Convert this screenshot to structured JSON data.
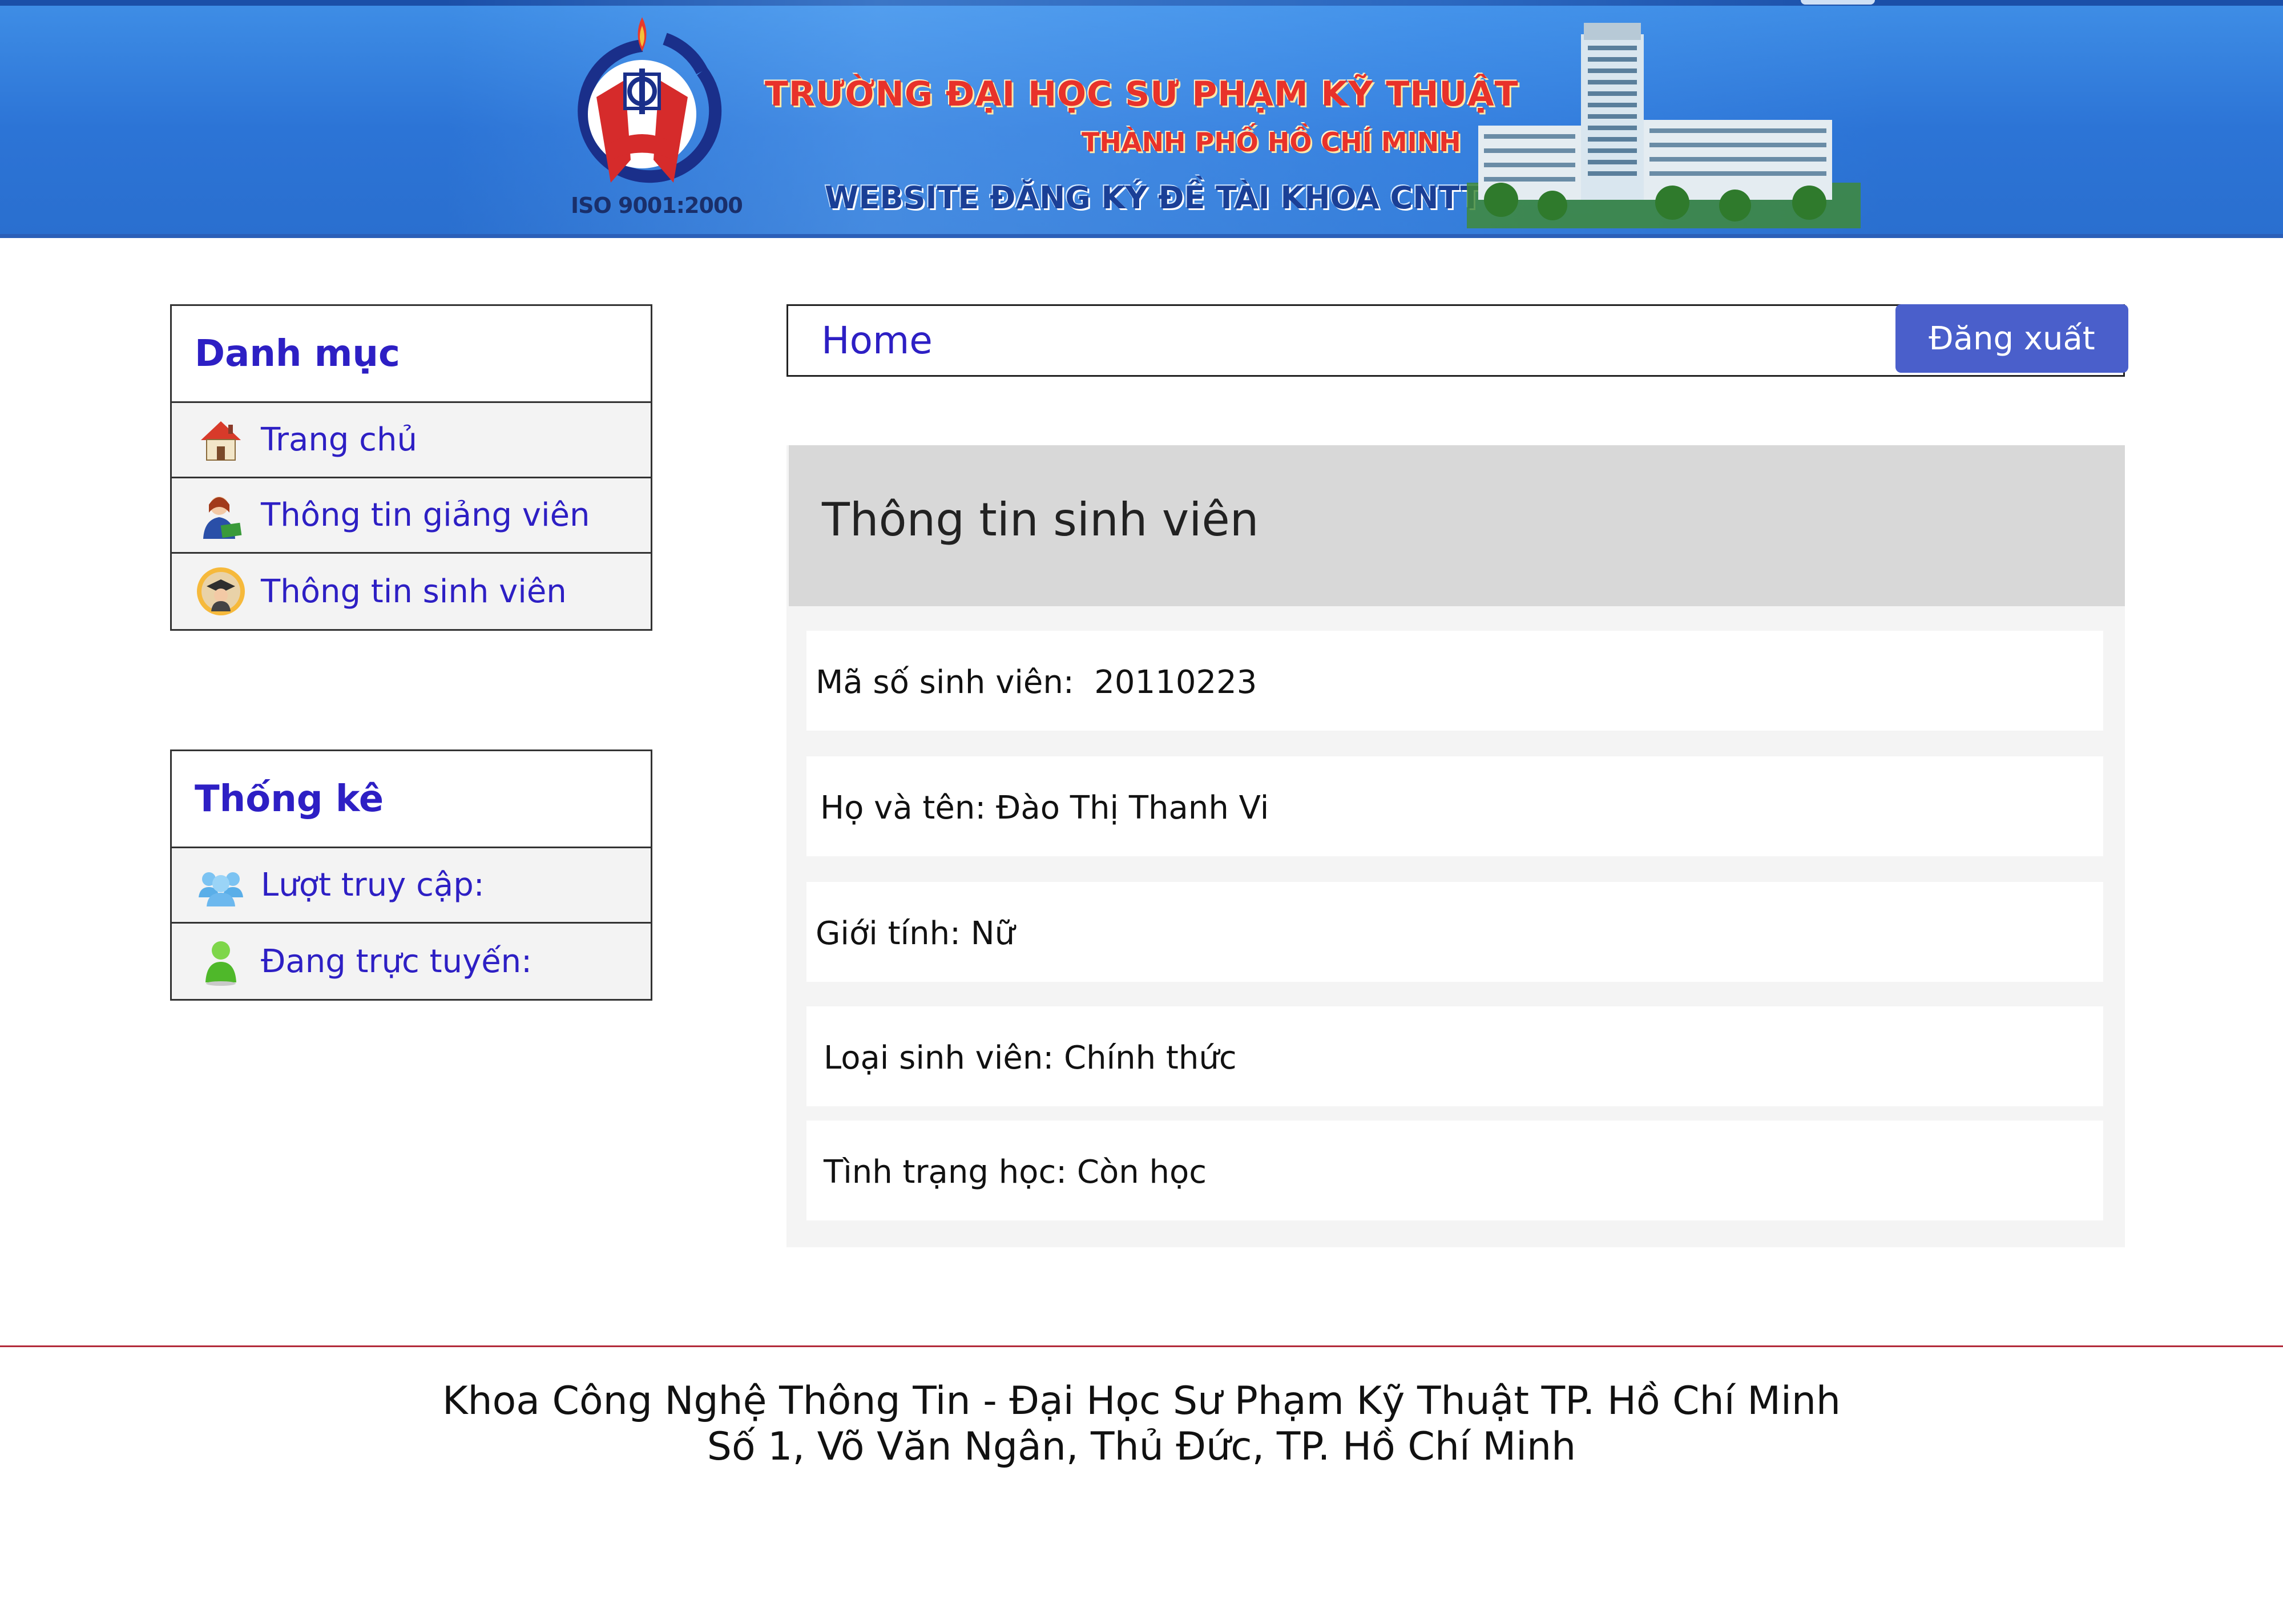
{
  "header": {
    "line1": "TRƯỜNG ĐẠI HỌC SƯ PHẠM KỸ THUẬT",
    "line2": "THÀNH PHỐ HỒ CHÍ MINH",
    "line3": "WEBSITE ĐĂNG KÝ ĐỀ TÀI KHOA CNTT",
    "iso": "ISO 9001:2000"
  },
  "sidebar": {
    "menu_title": "Danh mục",
    "menu_items": [
      {
        "label": "Trang chủ",
        "icon": "house-icon"
      },
      {
        "label": "Thông tin giảng viên",
        "icon": "teacher-icon"
      },
      {
        "label": "Thông tin sinh viên",
        "icon": "graduate-icon"
      }
    ],
    "stats_title": "Thống kê",
    "stats_items": [
      {
        "label": "Lượt truy cập:",
        "icon": "users-group-icon"
      },
      {
        "label": "Đang trực tuyến:",
        "icon": "online-user-icon"
      }
    ]
  },
  "nav": {
    "home": "Home",
    "logout": "Đăng xuất"
  },
  "student": {
    "title": "Thông tin sinh viên",
    "student_id": "Mã số sinh viên:  20110223",
    "full_name": "Họ và tên: Đào Thị Thanh Vi",
    "gender": "Giới tính: Nữ",
    "type": "Loại sinh viên: Chính thức",
    "status": "Tình trạng học: Còn học"
  },
  "footer": {
    "line1": "Khoa Công Nghệ Thông Tin - Đại Học Sư Phạm Kỹ Thuật TP. Hồ Chí Minh",
    "line2": "Số 1, Võ Văn Ngân, Thủ Đức, TP. Hồ Chí Minh"
  },
  "colors": {
    "accent": "#2d1fc4",
    "logout_bg": "#4a5fcb",
    "banner": "#2c74d6",
    "footer_line": "#b22a3a"
  }
}
